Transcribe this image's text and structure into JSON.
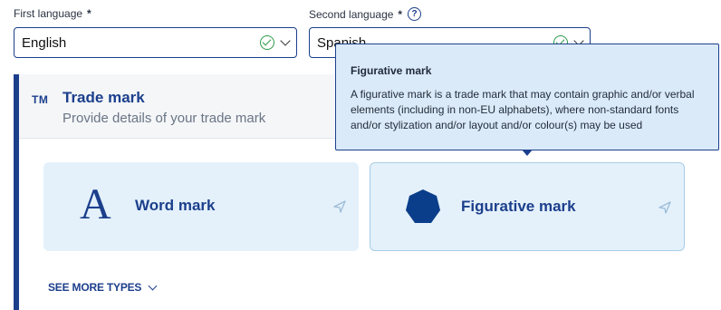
{
  "first_language": {
    "label": "First language",
    "required_mark": "*",
    "value": "English"
  },
  "second_language": {
    "label": "Second language",
    "required_mark": "*",
    "value": "Spanish",
    "help_icon": "?"
  },
  "trademark_panel": {
    "icon_text": "TM",
    "title": "Trade mark",
    "subtitle": "Provide details of your trade mark"
  },
  "mark_types": [
    {
      "glyph": "A",
      "label": "Word mark"
    },
    {
      "label": "Figurative mark"
    }
  ],
  "see_more": "SEE MORE TYPES",
  "tooltip": {
    "title": "Figurative mark",
    "text": "A figurative mark is a trade mark that may contain graphic and/or verbal elements (including in non-EU alphabets), where non-standard fonts and/or stylization and/or layout and/or colour(s) may be used"
  },
  "colors": {
    "primary": "#1c3f8c",
    "valid": "#2e9a48",
    "card_bg": "#e4f1fb",
    "tooltip_bg": "#dbeaf8"
  }
}
